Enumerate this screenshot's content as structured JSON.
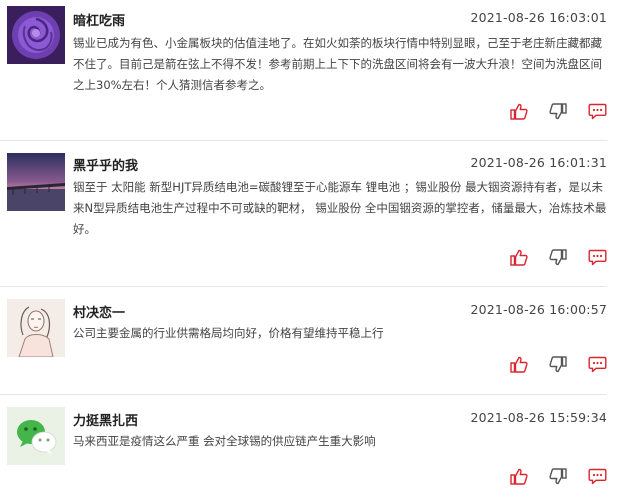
{
  "colors": {
    "accent": "#d9262e",
    "icon_gray": "#555555",
    "divider": "#e6e6e6"
  },
  "icons": {
    "like": "thumbs-up-icon",
    "dislike": "thumbs-down-icon",
    "comment": "comment-icon"
  },
  "posts": [
    {
      "username": "暗杠吃雨",
      "time": "2021-08-26 16:03:01",
      "content": "锡业已成为有色、小金属板块的估值洼地了。在如火如荼的板块行情中特别显眼，己至于老庄新庄藏都藏不住了。目前己是箭在弦上不得不发！参考前期上上下下的洗盘区间将会有一波大升浪！空间为洗盘区间之上30%左右！个人猜测信者参考之。",
      "avatar": "purple-rose"
    },
    {
      "username": "黑乎乎的我",
      "time": "2021-08-26 16:01:31",
      "content": "铟至于 太阳能 新型HJT异质结电池=碳酸锂至于心能源车 锂电池 ；锡业股份 最大铟资源持有者，是以未来N型异质结电池生产过程中不可或缺的靶材， 锡业股份 全中国铟资源的掌控者，储量最大，冶炼技术最好。",
      "avatar": "sunset-pier"
    },
    {
      "username": "村决恋一",
      "time": "2021-08-26 16:00:57",
      "content": "公司主要金属的行业供需格局均向好，价格有望维持平稳上行",
      "avatar": "sketch-girl"
    },
    {
      "username": "力挺黑扎西",
      "time": "2021-08-26 15:59:34",
      "content": "马来西亚是疫情这么严重 会对全球锡的供应链产生重大影响",
      "avatar": "wechat-logo"
    }
  ]
}
